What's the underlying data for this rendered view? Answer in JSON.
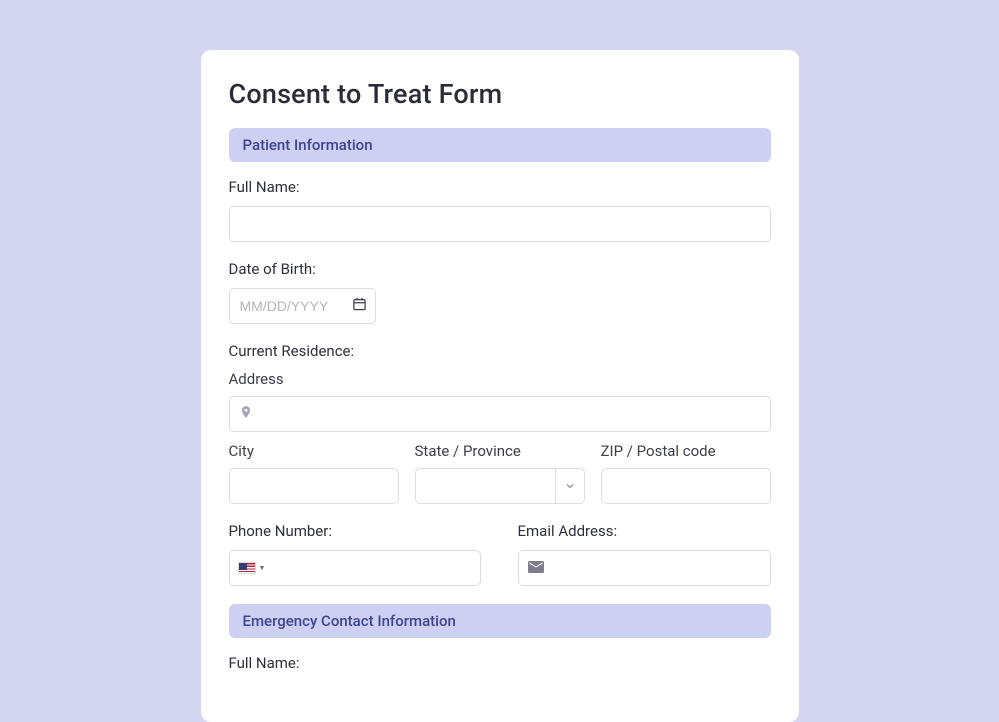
{
  "title": "Consent to Treat Form",
  "sections": {
    "patient_info": "Patient Information",
    "emergency_info": "Emergency Contact Information"
  },
  "labels": {
    "full_name": "Full Name:",
    "dob": "Date of Birth:",
    "current_residence": "Current Residence:",
    "address": "Address",
    "city": "City",
    "state": "State / Province",
    "zip": "ZIP / Postal code",
    "phone": "Phone Number:",
    "email": "Email Address:",
    "full_name_2": "Full Name:"
  },
  "placeholders": {
    "dob": "MM/DD/YYYY"
  },
  "values": {
    "full_name": "",
    "dob": "",
    "address": "",
    "city": "",
    "state": "",
    "zip": "",
    "phone": "",
    "email": ""
  }
}
